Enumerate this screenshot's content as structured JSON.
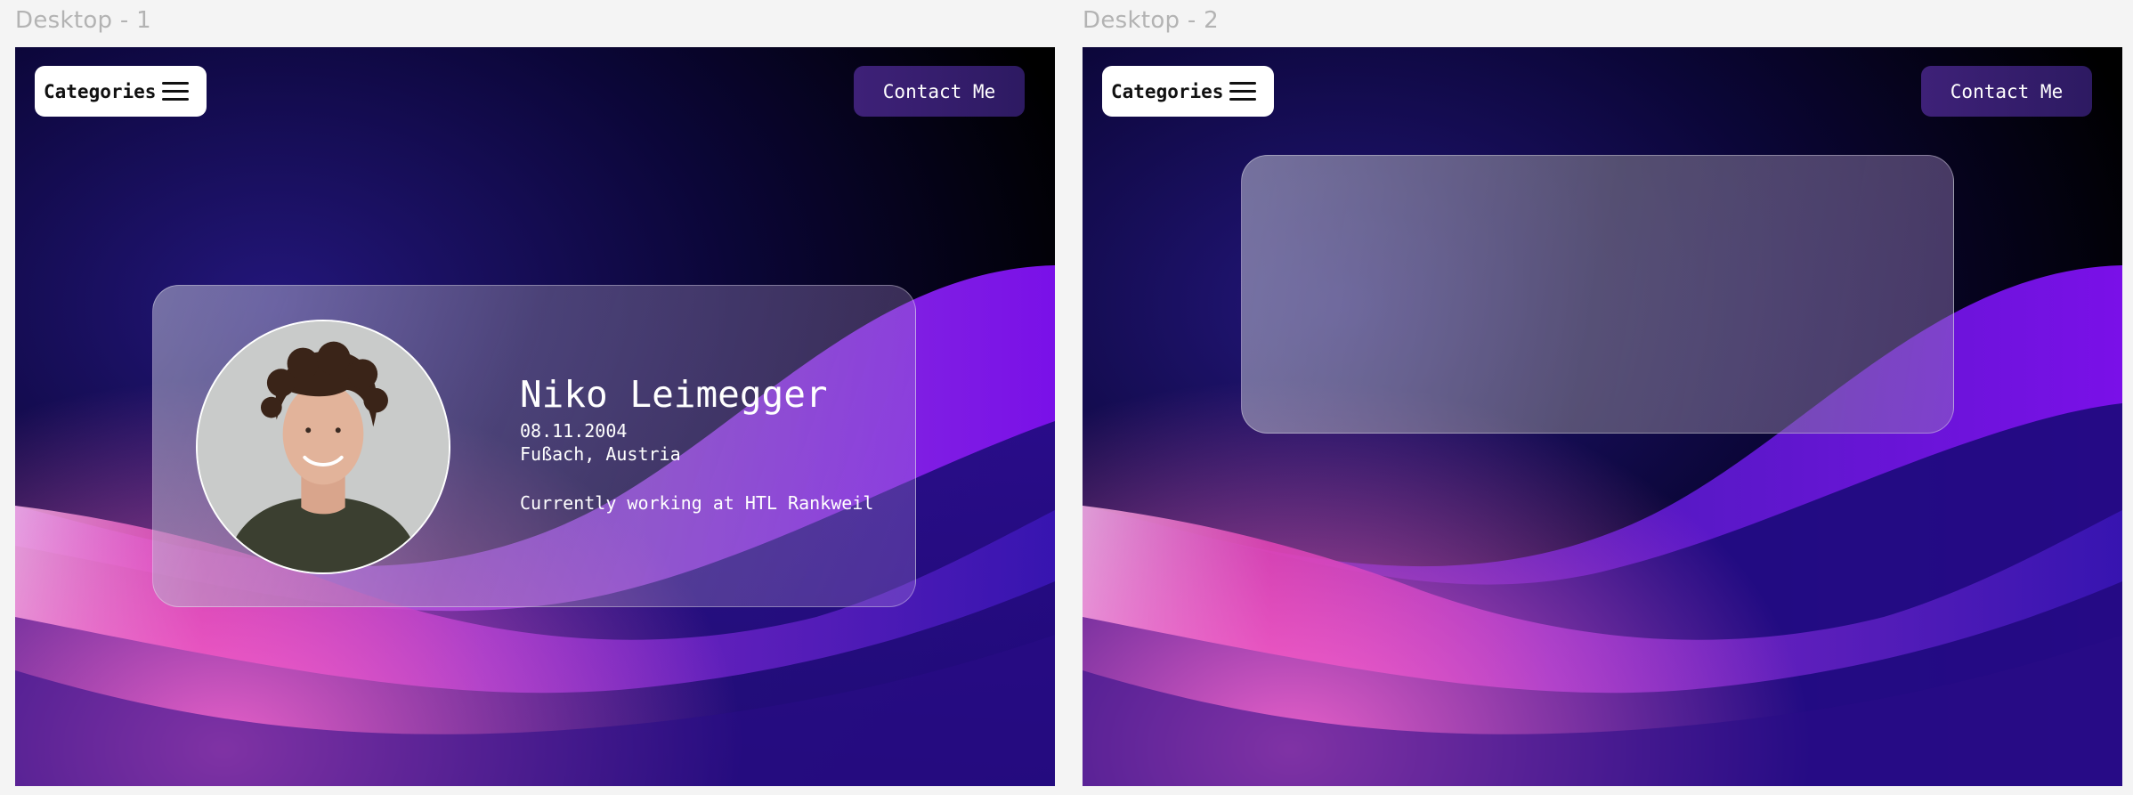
{
  "frames": [
    {
      "label": "Desktop - 1",
      "nav": {
        "categories_label": "Categories",
        "menu_icon": "hamburger-icon",
        "contact_label": "Contact Me"
      },
      "profile": {
        "name": "Niko Leimegger",
        "birth_date": "08.11.2004",
        "location": "Fußach, Austria",
        "work": "Currently working at HTL Rankweil"
      }
    },
    {
      "label": "Desktop - 2",
      "nav": {
        "categories_label": "Categories",
        "menu_icon": "hamburger-icon",
        "contact_label": "Contact Me"
      }
    }
  ],
  "colors": {
    "canvas": "#f4f4f4",
    "frame_label": "#b3b3b3",
    "contact_button": "#3e2178",
    "categories_button": "#ffffff",
    "wave_purple": "#7a1fe0",
    "wave_pink": "#e83fb4",
    "deep_blue": "#1a0a8a"
  }
}
